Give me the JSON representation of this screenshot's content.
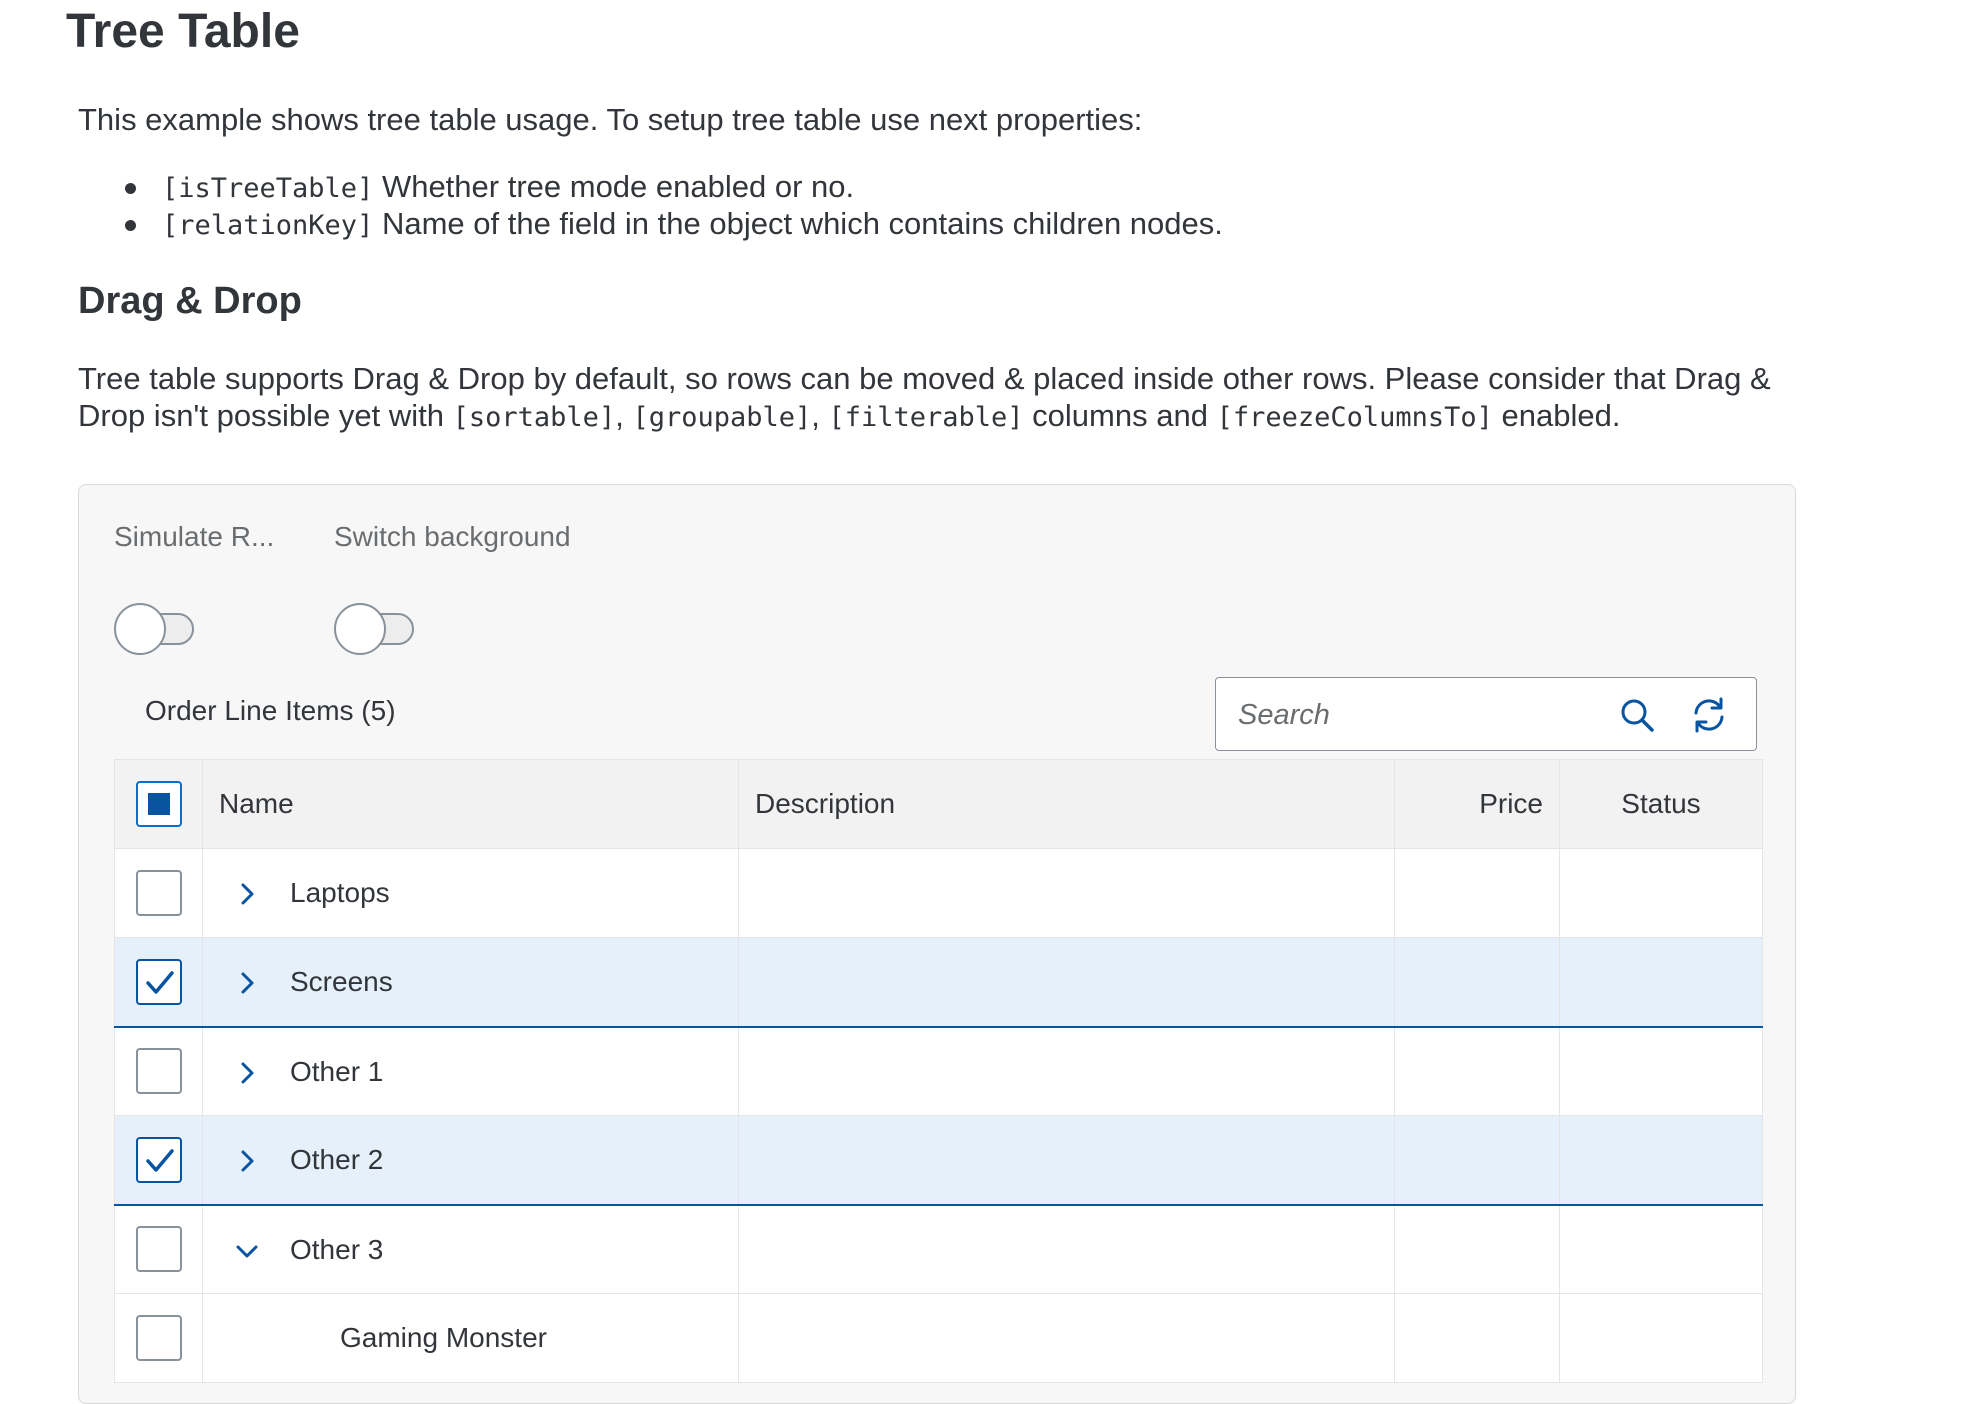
{
  "page": {
    "title": "Tree Table",
    "intro": "This example shows tree table usage. To setup tree table use next properties:",
    "properties": [
      {
        "code": "[isTreeTable]",
        "text": " Whether tree mode enabled or no."
      },
      {
        "code": "[relationKey]",
        "text": " Name of the field in the object which contains children nodes."
      }
    ],
    "dnd": {
      "title": "Drag & Drop",
      "text_1": "Tree table supports Drag & Drop by default, so rows can be moved & placed inside other rows. Please consider that Drag & Drop isn't possible yet with ",
      "code_1": "[sortable]",
      "sep_1": ", ",
      "code_2": "[groupable]",
      "sep_2": ", ",
      "code_3": "[filterable]",
      "text_2": " columns and ",
      "code_4": "[freezeColumnsTo]",
      "text_3": " enabled."
    }
  },
  "controls": {
    "simulate_label": "Simulate R...",
    "switch_bg_label": "Switch background"
  },
  "toolbar": {
    "title": "Order Line Items (5)",
    "search_placeholder": "Search"
  },
  "table": {
    "columns": {
      "name": "Name",
      "description": "Description",
      "price": "Price",
      "status": "Status"
    },
    "rows": [
      {
        "name": "Laptops",
        "selected": false,
        "expanded": false,
        "level": 0
      },
      {
        "name": "Screens",
        "selected": true,
        "expanded": false,
        "level": 0
      },
      {
        "name": "Other 1",
        "selected": false,
        "expanded": false,
        "level": 0
      },
      {
        "name": "Other 2",
        "selected": true,
        "expanded": false,
        "level": 0
      },
      {
        "name": "Other 3",
        "selected": false,
        "expanded": true,
        "level": 0
      },
      {
        "name": "Gaming Monster",
        "selected": false,
        "expanded": false,
        "level": 1
      }
    ]
  },
  "colors": {
    "accent": "#0854a0",
    "selected_row": "#e5f0fa",
    "text": "#32363a"
  }
}
